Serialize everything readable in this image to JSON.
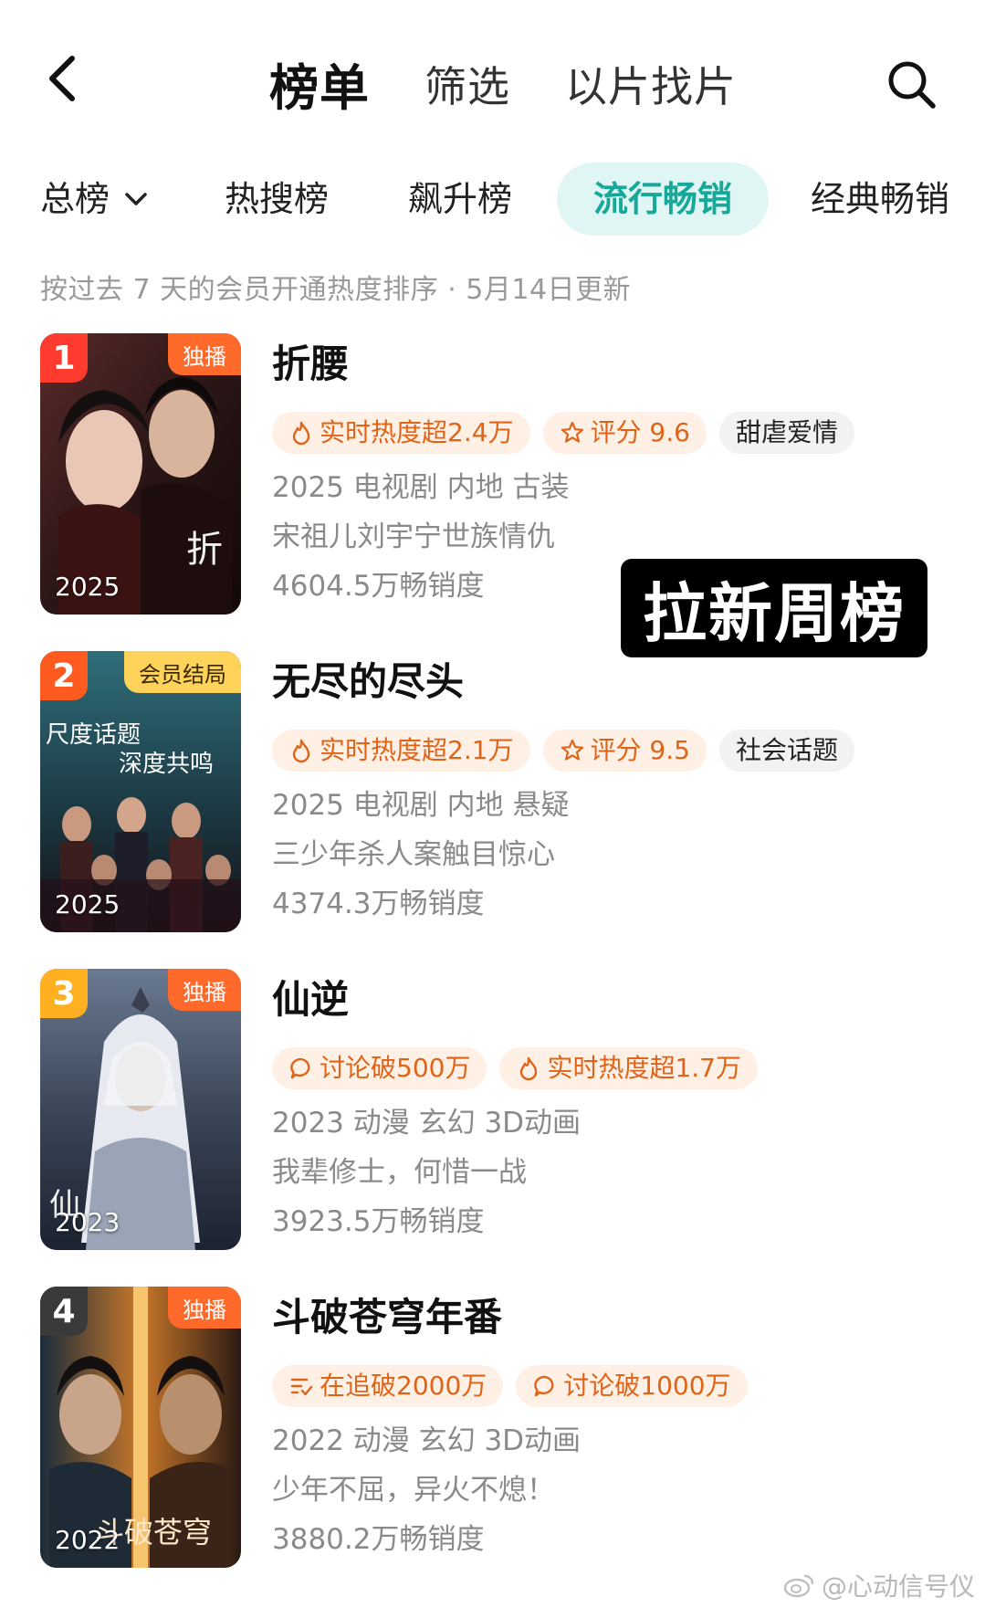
{
  "nav": {
    "tabs": [
      "榜单",
      "筛选",
      "以片找片"
    ]
  },
  "subtabs": [
    "总榜",
    "热搜榜",
    "飙升榜",
    "流行畅销",
    "经典畅销"
  ],
  "description": "按过去 7 天的会员开通热度排序 · 5月14日更新",
  "overlay_label": "拉新周榜",
  "watermark": "@心动信号仪",
  "colors": {
    "accent": "#16a898",
    "accent_bg": "#e0f6f4",
    "tag_orange": "#e06418",
    "tag_orange_bg": "#fff0e6",
    "rank1": "#ff3b2f",
    "rank2": "#ff5a1f",
    "rank3": "#ffb020",
    "rank4": "#3a3a3a"
  },
  "items": [
    {
      "rank": "1",
      "badge": "独播",
      "year": "2025",
      "title": "折腰",
      "tags": [
        {
          "icon": "flame-icon",
          "text": "实时热度超2.4万",
          "style": "hot"
        },
        {
          "icon": "star-icon",
          "text": "评分 9.6",
          "style": "hot"
        },
        {
          "icon": "",
          "text": "甜虐爱情",
          "style": "gray"
        }
      ],
      "meta": "2025 电视剧 内地 古装",
      "tagline": "宋祖儿刘宇宁世族情仇",
      "sales": "4604.5万畅销度"
    },
    {
      "rank": "2",
      "badge": "会员结局",
      "year": "2025",
      "title": "无尽的尽头",
      "tags": [
        {
          "icon": "flame-icon",
          "text": "实时热度超2.1万",
          "style": "hot"
        },
        {
          "icon": "star-icon",
          "text": "评分 9.5",
          "style": "hot"
        },
        {
          "icon": "",
          "text": "社会话题",
          "style": "gray"
        }
      ],
      "meta": "2025 电视剧 内地 悬疑",
      "tagline": "三少年杀人案触目惊心",
      "sales": "4374.3万畅销度"
    },
    {
      "rank": "3",
      "badge": "独播",
      "year": "2023",
      "title": "仙逆",
      "tags": [
        {
          "icon": "comment-icon",
          "text": "讨论破500万",
          "style": "hot"
        },
        {
          "icon": "flame-icon",
          "text": "实时热度超1.7万",
          "style": "hot"
        }
      ],
      "meta": "2023 动漫 玄幻 3D动画",
      "tagline": "我辈修士，何惜一战",
      "sales": "3923.5万畅销度"
    },
    {
      "rank": "4",
      "badge": "独播",
      "year": "2022",
      "title": "斗破苍穹年番",
      "tags": [
        {
          "icon": "list-check-icon",
          "text": "在追破2000万",
          "style": "hot"
        },
        {
          "icon": "comment-icon",
          "text": "讨论破1000万",
          "style": "hot"
        }
      ],
      "meta": "2022 动漫 玄幻 3D动画",
      "tagline": "少年不屈，异火不熄！",
      "sales": "3880.2万畅销度"
    }
  ]
}
